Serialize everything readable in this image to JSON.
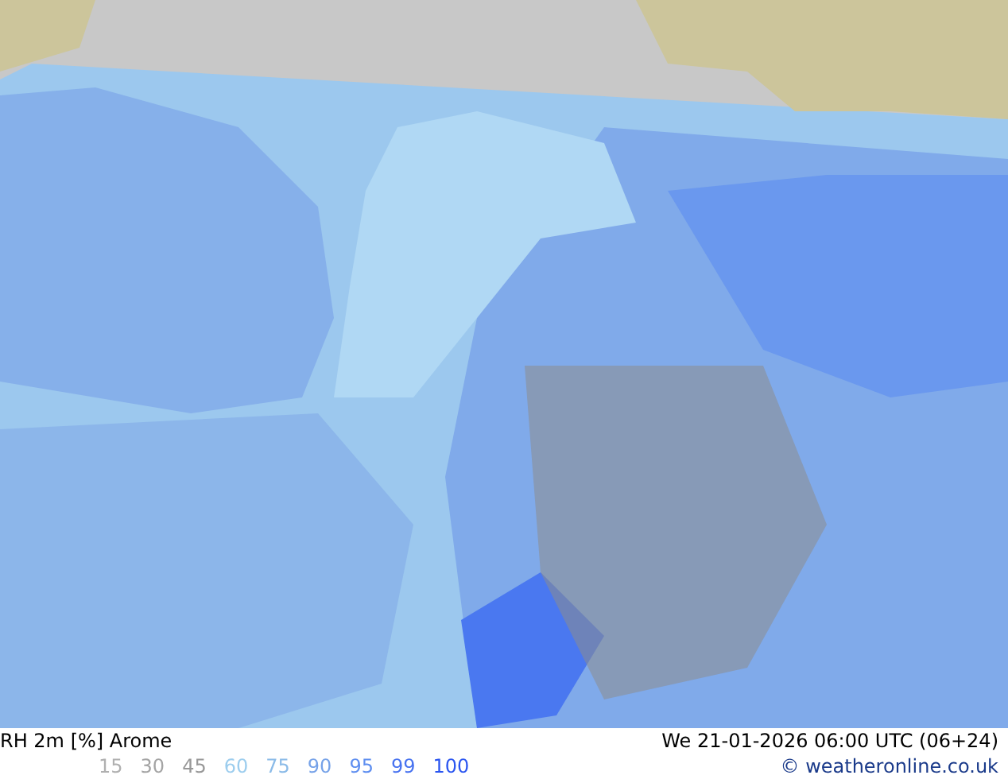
{
  "map_title": "RH 2m [%] Arome",
  "valid_time": "We 21-01-2026 06:00 UTC (06+24)",
  "legend": [
    {
      "label": "15",
      "color": "#b0b0b0"
    },
    {
      "label": "30",
      "color": "#a4a4a4"
    },
    {
      "label": "45",
      "color": "#989898"
    },
    {
      "label": "60",
      "color": "#9ccdee"
    },
    {
      "label": "75",
      "color": "#8bbbe8"
    },
    {
      "label": "90",
      "color": "#76a2e8"
    },
    {
      "label": "95",
      "color": "#5e8ef0"
    },
    {
      "label": "99",
      "color": "#4772f0"
    },
    {
      "label": "100",
      "color": "#2a55f0"
    }
  ],
  "credit": "© weatheronline.co.uk"
}
